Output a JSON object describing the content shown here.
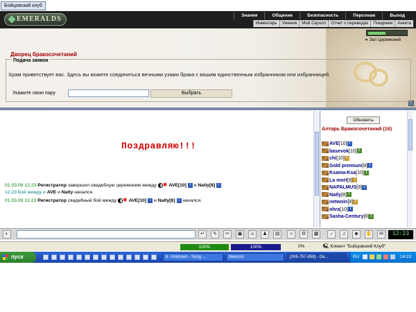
{
  "window": {
    "title": "Бойцовский клуб"
  },
  "header": {
    "logo": "EMERALDS",
    "menu_top": [
      "Знания",
      "Общение",
      "Безопасность",
      "Персонаж",
      "Выход"
    ],
    "menu_bottom": [
      "Инвентарь",
      "Умения",
      "Мой Скролл",
      "Отчет о переводах",
      "Поединки",
      "Анкета"
    ]
  },
  "location": {
    "title": "Дворец бракосочетаний",
    "section_legend": "Подача заявок",
    "welcome": "Храм приветствует вас. Здесь вы можете соединиться вечными узами брака с вашим единственным избранником или избранницей.",
    "pair_label": "Укажите свою пару",
    "pair_value": "",
    "choose_button": "Выбрать",
    "hall_label": "Зал Церемоний",
    "hall_progress": 0.45
  },
  "chat": {
    "congrats": "Поздравляю!!!",
    "messages": [
      {
        "time": "01.03.09 12:23",
        "author": "Регистратор",
        "text_a": "завершил свадебную церемонию между",
        "p1": "AVE",
        "p1_lvl": "[10]",
        "joiner": "и",
        "p2": "Natly",
        "p2_lvl": "[8]",
        "end": "."
      },
      {
        "time": "12:23",
        "text_a": "Бой между и",
        "p1": "AVE",
        "joiner": "и",
        "p2": "Natly",
        "end": "начался."
      },
      {
        "time": "01.03.09 12:23",
        "author": "Регистратор",
        "text_a": "свадебный бой между",
        "p1": "AVE",
        "p1_lvl": "[10]",
        "joiner": "и",
        "p2": "Natly",
        "p2_lvl": "[8]",
        "end": "начался."
      }
    ],
    "input_value": ""
  },
  "right_panel": {
    "refresh_button": "Обновить",
    "title": "Алтарь Бракосочетаний (16)",
    "users": [
      {
        "name": "AVE",
        "level": "[10]"
      },
      {
        "name": "basevok",
        "level": "[10]"
      },
      {
        "name": "chi",
        "level": "[10]"
      },
      {
        "name": "Gold premium",
        "level": "[9]"
      },
      {
        "name": "Ksama-Ksa",
        "level": "[10]"
      },
      {
        "name": "La mort",
        "level": "[9]"
      },
      {
        "name": "NAPALMUS",
        "level": "[9]"
      },
      {
        "name": "Natly",
        "level": "[8]"
      },
      {
        "name": "netwoin",
        "level": "[8]"
      },
      {
        "name": "ohra",
        "level": "[10]"
      },
      {
        "name": "Sasha-Century",
        "level": "[8]"
      }
    ]
  },
  "toolbar": {
    "clock": "12:23"
  },
  "status": {
    "hp_percent": "100%",
    "mp_percent": "100%",
    "extra_percent": "0%",
    "client_label": "Клиент \"Бойцовский Клуб\""
  },
  "taskbar": {
    "start_label": "пуск",
    "tasks": [
      "6. Unknown - Song ...",
      "bkencicl",
      "[306-757-858] - Ок..."
    ],
    "lang": "RU",
    "time": "14:23"
  },
  "colors": {
    "accent_red": "#a00000",
    "congrats_red": "#d10000",
    "hp_green": "#1f8a12",
    "mp_blue": "#1b1b8e",
    "taskbar_blue": "#2454c0"
  }
}
